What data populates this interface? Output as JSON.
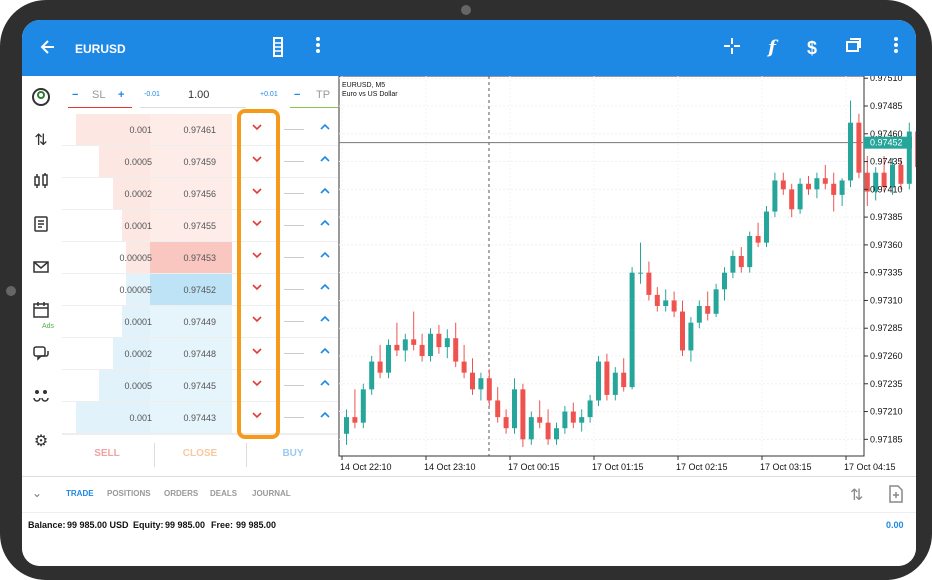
{
  "app": {
    "symbol": "EURUSD",
    "icons": [
      "arrow-back-icon",
      "price-ladder-icon",
      "more-vertical-icon",
      "crosshair-icon",
      "indicators-icon",
      "trade-dollar-icon",
      "windows-icon",
      "more-vertical-icon"
    ]
  },
  "leftnav": {
    "items": [
      {
        "name": "quotes-icon"
      },
      {
        "name": "trade-arrows-icon"
      },
      {
        "name": "chart-icon"
      },
      {
        "name": "news-icon"
      },
      {
        "name": "mail-icon"
      },
      {
        "name": "calendar-icon",
        "badge": "Ads"
      },
      {
        "name": "chat-icon"
      },
      {
        "name": "community-icon"
      },
      {
        "name": "settings-icon"
      }
    ]
  },
  "dom": {
    "sl_label": "SL",
    "tp_label": "TP",
    "minus": "−",
    "plus": "+",
    "volume": "1.00",
    "step_left": "-0.01",
    "step_right": "+0.01",
    "rows": [
      {
        "vol": "0.001",
        "price": "0.97461",
        "side": "sell",
        "depth": 0.85
      },
      {
        "vol": "0.0005",
        "price": "0.97459",
        "side": "sell",
        "depth": 0.6
      },
      {
        "vol": "0.0002",
        "price": "0.97456",
        "side": "sell",
        "depth": 0.45
      },
      {
        "vol": "0.0001",
        "price": "0.97455",
        "side": "sell",
        "depth": 0.35
      },
      {
        "vol": "0.00005",
        "price": "0.97453",
        "side": "sell",
        "depth": 0.3
      },
      {
        "vol": "0.00005",
        "price": "0.97452",
        "side": "buy",
        "depth": 0.3
      },
      {
        "vol": "0.0001",
        "price": "0.97449",
        "side": "buy",
        "depth": 0.35
      },
      {
        "vol": "0.0002",
        "price": "0.97448",
        "side": "buy",
        "depth": 0.45
      },
      {
        "vol": "0.0005",
        "price": "0.97445",
        "side": "buy",
        "depth": 0.6
      },
      {
        "vol": "0.001",
        "price": "0.97443",
        "side": "buy",
        "depth": 0.85
      }
    ],
    "sell_label": "SELL",
    "close_label": "CLOSE",
    "buy_label": "BUY"
  },
  "chart": {
    "symbol_line": "EURUSD, M5",
    "desc_line": "Euro vs US Dollar",
    "current_price": "0.97452",
    "colors": {
      "bull": "#26a69a",
      "bear": "#ef5350",
      "price_tag": "#26a69a"
    },
    "y_ticks": [
      "0.97510",
      "0.97485",
      "0.97460",
      "0.97435",
      "0.97410",
      "0.97385",
      "0.97360",
      "0.97335",
      "0.97310",
      "0.97285",
      "0.97260",
      "0.97235",
      "0.97210",
      "0.97185"
    ],
    "x_ticks": [
      "14 Oct 22:10",
      "14 Oct 23:10",
      "17 Oct 00:15",
      "17 Oct 01:15",
      "17 Oct 02:15",
      "17 Oct 03:15",
      "17 Oct 04:15"
    ]
  },
  "chart_data": {
    "type": "candlestick",
    "title": "EURUSD, M5",
    "subtitle": "Euro vs US Dollar",
    "y_range": [
      0.9717,
      0.97512
    ],
    "current": 0.97452,
    "candles": [
      [
        0.9719,
        0.97212,
        0.9718,
        0.97205
      ],
      [
        0.97205,
        0.9723,
        0.97195,
        0.972
      ],
      [
        0.972,
        0.97235,
        0.97195,
        0.9723
      ],
      [
        0.9723,
        0.9726,
        0.97225,
        0.97255
      ],
      [
        0.97255,
        0.9727,
        0.9724,
        0.97245
      ],
      [
        0.97245,
        0.97275,
        0.9724,
        0.9727
      ],
      [
        0.9727,
        0.9729,
        0.9726,
        0.97265
      ],
      [
        0.97265,
        0.9728,
        0.97255,
        0.97275
      ],
      [
        0.97275,
        0.973,
        0.97265,
        0.9727
      ],
      [
        0.9727,
        0.9728,
        0.97255,
        0.9726
      ],
      [
        0.9726,
        0.97285,
        0.97255,
        0.9728
      ],
      [
        0.9728,
        0.97288,
        0.97262,
        0.97268
      ],
      [
        0.97268,
        0.97284,
        0.97258,
        0.97276
      ],
      [
        0.97276,
        0.9729,
        0.9725,
        0.97255
      ],
      [
        0.97255,
        0.9727,
        0.9724,
        0.97245
      ],
      [
        0.97245,
        0.97258,
        0.97225,
        0.9723
      ],
      [
        0.9723,
        0.97245,
        0.9722,
        0.9724
      ],
      [
        0.9724,
        0.97248,
        0.97215,
        0.9722
      ],
      [
        0.9722,
        0.97232,
        0.972,
        0.97205
      ],
      [
        0.97205,
        0.97212,
        0.9719,
        0.97195
      ],
      [
        0.97195,
        0.9724,
        0.9719,
        0.9723
      ],
      [
        0.9723,
        0.97235,
        0.97178,
        0.97185
      ],
      [
        0.97185,
        0.9721,
        0.9718,
        0.97205
      ],
      [
        0.97205,
        0.9722,
        0.97195,
        0.972
      ],
      [
        0.972,
        0.97212,
        0.9718,
        0.97185
      ],
      [
        0.97185,
        0.972,
        0.9718,
        0.97195
      ],
      [
        0.97195,
        0.97215,
        0.9719,
        0.9721
      ],
      [
        0.9721,
        0.97218,
        0.97195,
        0.972
      ],
      [
        0.972,
        0.97212,
        0.97192,
        0.97205
      ],
      [
        0.97205,
        0.97225,
        0.972,
        0.9722
      ],
      [
        0.9722,
        0.9726,
        0.97215,
        0.97255
      ],
      [
        0.97255,
        0.97262,
        0.9722,
        0.97225
      ],
      [
        0.97225,
        0.9725,
        0.9722,
        0.97245
      ],
      [
        0.97245,
        0.97258,
        0.97228,
        0.97232
      ],
      [
        0.97232,
        0.9734,
        0.9723,
        0.97335
      ],
      [
        0.97335,
        0.97362,
        0.97325,
        0.97335
      ],
      [
        0.97335,
        0.97345,
        0.9731,
        0.97315
      ],
      [
        0.97315,
        0.97322,
        0.973,
        0.97305
      ],
      [
        0.97305,
        0.9732,
        0.973,
        0.9731
      ],
      [
        0.9731,
        0.97318,
        0.97295,
        0.973
      ],
      [
        0.973,
        0.9731,
        0.9726,
        0.97265
      ],
      [
        0.97265,
        0.97295,
        0.97255,
        0.9729
      ],
      [
        0.9729,
        0.9731,
        0.97285,
        0.97305
      ],
      [
        0.97305,
        0.97318,
        0.97292,
        0.97298
      ],
      [
        0.97298,
        0.97325,
        0.97295,
        0.9732
      ],
      [
        0.9732,
        0.9734,
        0.9731,
        0.97335
      ],
      [
        0.97335,
        0.97355,
        0.9733,
        0.9735
      ],
      [
        0.9735,
        0.97358,
        0.97335,
        0.9734
      ],
      [
        0.9734,
        0.97372,
        0.97335,
        0.97368
      ],
      [
        0.97368,
        0.9738,
        0.97358,
        0.97362
      ],
      [
        0.97362,
        0.97395,
        0.97358,
        0.9739
      ],
      [
        0.9739,
        0.97425,
        0.97385,
        0.97418
      ],
      [
        0.97418,
        0.97425,
        0.97405,
        0.9741
      ],
      [
        0.9741,
        0.97415,
        0.97385,
        0.97392
      ],
      [
        0.97392,
        0.9742,
        0.97388,
        0.97415
      ],
      [
        0.97415,
        0.97422,
        0.97405,
        0.9741
      ],
      [
        0.9741,
        0.97425,
        0.97402,
        0.9742
      ],
      [
        0.9742,
        0.97432,
        0.9741,
        0.97415
      ],
      [
        0.97415,
        0.97425,
        0.9739,
        0.97405
      ],
      [
        0.97405,
        0.9742,
        0.97395,
        0.97418
      ],
      [
        0.97418,
        0.9749,
        0.97412,
        0.9747
      ],
      [
        0.9747,
        0.97478,
        0.9742,
        0.97425
      ],
      [
        0.97425,
        0.9744,
        0.97395,
        0.97408
      ],
      [
        0.97408,
        0.9743,
        0.974,
        0.97425
      ],
      [
        0.97425,
        0.9744,
        0.97408,
        0.97412
      ],
      [
        0.97412,
        0.97438,
        0.97405,
        0.97432
      ],
      [
        0.97432,
        0.97438,
        0.9741,
        0.97415
      ],
      [
        0.97415,
        0.9747,
        0.9741,
        0.97462
      ],
      [
        0.97462,
        0.9747,
        0.97425,
        0.9743
      ],
      [
        0.9743,
        0.97485,
        0.97425,
        0.9748
      ],
      [
        0.9748,
        0.975,
        0.97435,
        0.9744
      ],
      [
        0.9744,
        0.97455,
        0.97435,
        0.97448
      ],
      [
        0.97448,
        0.97452,
        0.97415,
        0.9742
      ],
      [
        0.9742,
        0.97432,
        0.974,
        0.97415
      ],
      [
        0.97415,
        0.97425,
        0.974,
        0.9741
      ],
      [
        0.9741,
        0.9743,
        0.9739,
        0.97418
      ],
      [
        0.97418,
        0.97425,
        0.97408,
        0.97412
      ],
      [
        0.97412,
        0.97455,
        0.97405,
        0.97452
      ]
    ],
    "x_tick_labels": [
      "14 Oct 22:10",
      "14 Oct 23:10",
      "17 Oct 00:15",
      "17 Oct 01:15",
      "17 Oct 02:15",
      "17 Oct 03:15",
      "17 Oct 04:15"
    ],
    "y_tick_labels": [
      "0.97510",
      "0.97485",
      "0.97460",
      "0.97435",
      "0.97410",
      "0.97385",
      "0.97360",
      "0.97335",
      "0.97310",
      "0.97285",
      "0.97260",
      "0.97235",
      "0.97210",
      "0.97185"
    ],
    "grid": true
  },
  "bottom": {
    "tabs": [
      "TRADE",
      "POSITIONS",
      "ORDERS",
      "DEALS",
      "JOURNAL"
    ],
    "balance_label": "Balance:",
    "balance_value": "99 985.00 USD",
    "equity_label": "Equity:",
    "equity_value": "99 985.00",
    "free_label": "Free:",
    "free_value": "99 985.00",
    "profit": "0.00"
  }
}
